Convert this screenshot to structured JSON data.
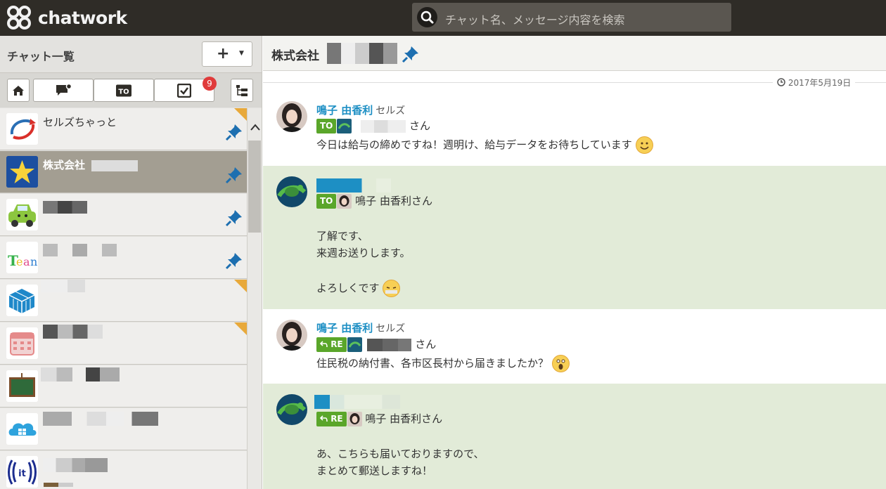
{
  "app": {
    "logo_text": "chatwork"
  },
  "search": {
    "placeholder": "チャット名、メッセージ内容を検索"
  },
  "sidebar": {
    "title": "チャット一覧",
    "add_label": "+",
    "task_badge": "9",
    "rooms": [
      {
        "name": "セルズちゃっと"
      },
      {
        "name": "株式会社"
      }
    ]
  },
  "room": {
    "title": "株式会社"
  },
  "timeline": {
    "date": "2017年5月19日",
    "messages": [
      {
        "sender": "鳴子 由香利",
        "org": "セルズ",
        "to_label": "TO",
        "to_suffix": "さん",
        "text1": "今日は給与の締めですね！週明け、給与データをお待ちしています"
      },
      {
        "to_label": "TO",
        "to_text": "鳴子 由香利さん",
        "text1": "了解です、",
        "text2": "来週お送りします。",
        "text3": "よろしくです"
      },
      {
        "sender": "鳴子 由香利",
        "org": "セルズ",
        "re_label": "RE",
        "re_suffix": "さん",
        "text1": "住民税の納付書、各市区長村から届きましたか？"
      },
      {
        "re_label": "RE",
        "re_text": "鳴子 由香利さん",
        "text1": "あ、こちらも届いておりますので、",
        "text2": "まとめて郵送しますね！"
      }
    ]
  },
  "colors": {
    "topbar": "#2f2c27",
    "accent_blue": "#1d8fc4",
    "tag_green": "#5aa62a",
    "message_green": "#e2ebd8",
    "active_room": "#a39e92"
  }
}
